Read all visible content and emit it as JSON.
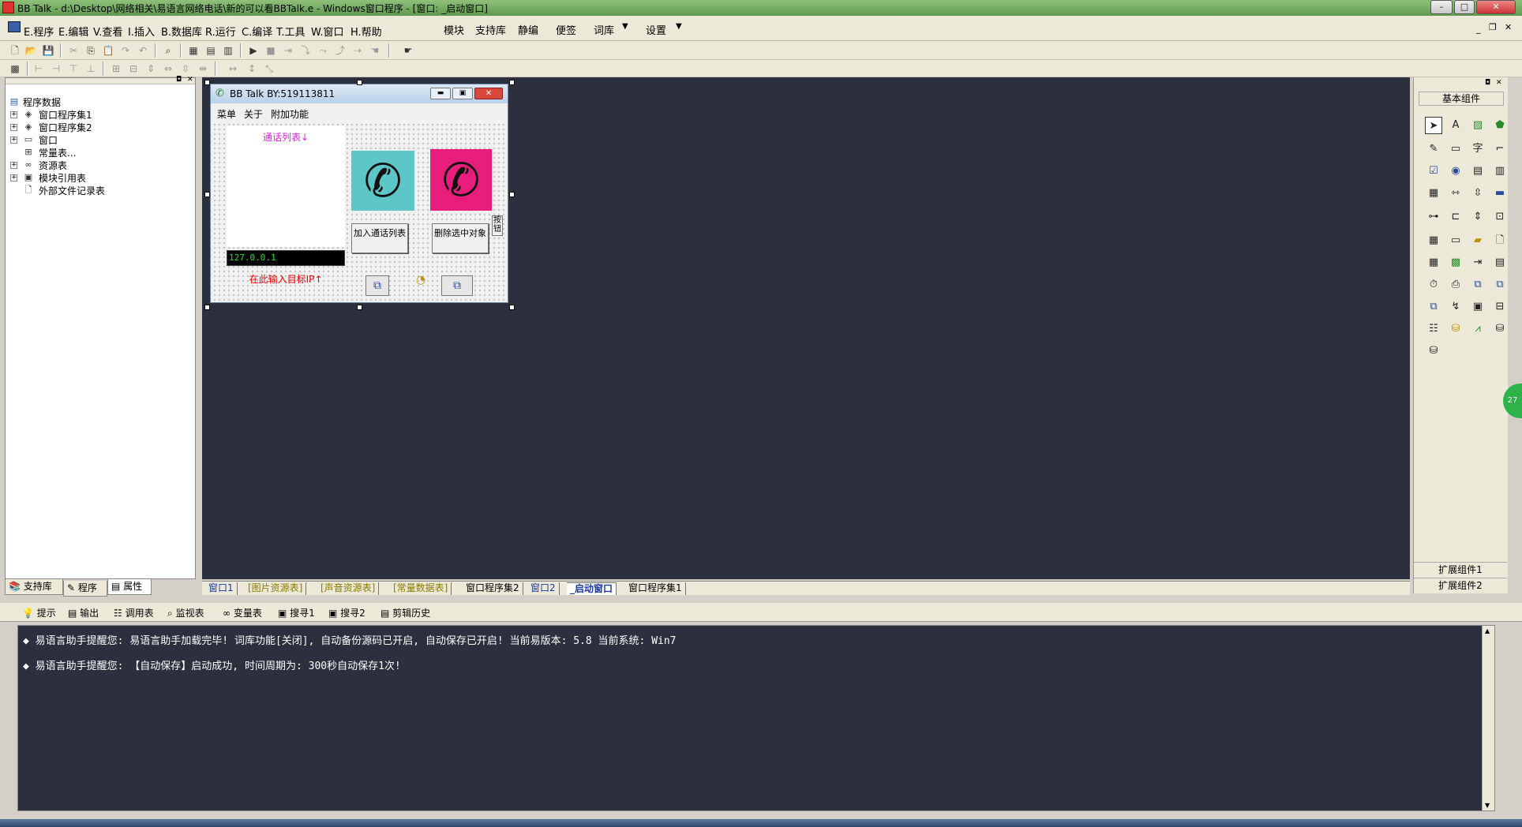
{
  "window": {
    "title": "BB Talk - d:\\Desktop\\网络相关\\易语言网络电话\\新的可以看BBTalk.e - Windows窗口程序 - [窗口: _启动窗口]"
  },
  "menubar": {
    "items": [
      "E.程序",
      "E.编辑",
      "V.查看",
      "I.插入",
      "B.数据库",
      "R.运行",
      "C.编译",
      "T.工具",
      "W.窗口",
      "H.帮助"
    ],
    "extras": [
      "模块",
      "支持库",
      "静编",
      "便签",
      "词库",
      "设置"
    ]
  },
  "left_panel": {
    "tree": [
      {
        "label": "程序数据",
        "root": true
      },
      {
        "label": "窗口程序集1",
        "toggle": "+"
      },
      {
        "label": "窗口程序集2",
        "toggle": "+"
      },
      {
        "label": "窗口",
        "toggle": "+"
      },
      {
        "label": "常量表...",
        "toggle": ""
      },
      {
        "label": "资源表",
        "toggle": "+"
      },
      {
        "label": "模块引用表",
        "toggle": "+"
      },
      {
        "label": "外部文件记录表",
        "toggle": ""
      }
    ],
    "tabs": [
      "支持库",
      "程序",
      "属性"
    ]
  },
  "form": {
    "title": "BB Talk BY:519113811",
    "menu": [
      "菜单",
      "关于",
      "附加功能"
    ],
    "list_label": "通话列表↓",
    "ip_value": "127.0.0.1",
    "ip_hint": "在此输入目标IP↑",
    "btn_add": "加入通话列表",
    "btn_delete": "删除选中对象",
    "btn_side": "按钮",
    "colors": {
      "call_green": "#5cc7c6",
      "call_red": "#e91e7c"
    }
  },
  "doc_tabs": [
    "窗口1",
    "[图片资源表]",
    "[声音资源表]",
    "[常量数据表]",
    "窗口程序集2",
    "窗口2",
    "_启动窗口",
    "窗口程序集1"
  ],
  "palette": {
    "header": "基本组件",
    "footer1": "扩展组件1",
    "footer2": "扩展组件2"
  },
  "output_tabs": [
    "提示",
    "输出",
    "调用表",
    "监视表",
    "变量表",
    "搜寻1",
    "搜寻2",
    "剪辑历史"
  ],
  "output_lines": [
    "易语言助手提醒您:  易语言助手加载完毕! 词库功能[关闭], 自动备份源码已开启, 自动保存已开启!  当前易版本: 5.8  当前系统: Win7",
    "易语言助手提醒您: 【自动保存】启动成功, 时间周期为: 300秒自动保存1次!"
  ],
  "badge": "27"
}
